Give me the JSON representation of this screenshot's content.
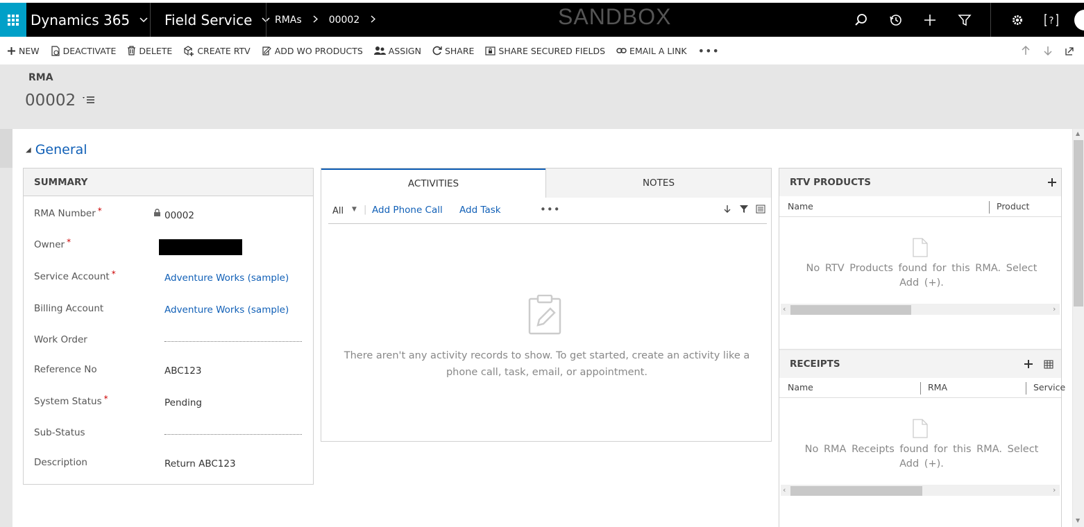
{
  "topnav": {
    "app_name": "Dynamics 365",
    "area_name": "Field Service",
    "breadcrumb": [
      "RMAs",
      "00002"
    ],
    "environment_label": "SANDBOX",
    "icons": [
      "search-icon",
      "recent-icon",
      "add-icon",
      "filter-icon",
      "settings-icon",
      "help-icon",
      "user-avatar"
    ]
  },
  "commandbar": {
    "new": "NEW",
    "deactivate": "DEACTIVATE",
    "delete": "DELETE",
    "create_rtv": "CREATE RTV",
    "add_wo_products": "ADD WO PRODUCTS",
    "assign": "ASSIGN",
    "share": "SHARE",
    "share_secured_fields": "SHARE SECURED FIELDS",
    "email_a_link": "EMAIL A LINK",
    "more": "•••"
  },
  "header": {
    "entity_type": "RMA",
    "record_title": "00002"
  },
  "section": {
    "title": "General"
  },
  "summary": {
    "title": "SUMMARY",
    "fields": [
      {
        "label": "RMA Number",
        "required": true,
        "value": "00002",
        "locked": true
      },
      {
        "label": "Owner",
        "required": true,
        "value": "",
        "redacted": true
      },
      {
        "label": "Service Account",
        "required": true,
        "value": "Adventure Works (sample)",
        "link": true
      },
      {
        "label": "Billing Account",
        "required": false,
        "value": "Adventure Works (sample)",
        "link": true
      },
      {
        "label": "Work Order",
        "required": false,
        "value": ""
      },
      {
        "label": "Reference No",
        "required": false,
        "value": "ABC123"
      },
      {
        "label": "System Status",
        "required": true,
        "value": "Pending"
      },
      {
        "label": "Sub-Status",
        "required": false,
        "value": ""
      },
      {
        "label": "Description",
        "required": false,
        "value": "Return ABC123"
      }
    ],
    "required_mark": "*"
  },
  "activities": {
    "tab_activities": "ACTIVITIES",
    "tab_notes": "NOTES",
    "filter_value": "All",
    "separator": "|",
    "add_phone_call": "Add Phone Call",
    "add_task": "Add Task",
    "more": "•••",
    "empty_message": "There aren't any activity records to show. To get started, create an activity like a phone call, task, email, or appointment."
  },
  "rtv_products": {
    "title": "RTV PRODUCTS",
    "columns": [
      "Name",
      "Product"
    ],
    "empty_message": "No RTV Products found for this RMA. Select Add (+)."
  },
  "receipts": {
    "title": "RECEIPTS",
    "columns": [
      "Name",
      "RMA",
      "Service"
    ],
    "empty_message": "No RMA Receipts found for this RMA. Select Add (+)."
  },
  "colors": {
    "nav_bg": "#000000",
    "waffle_bg": "#00a0c8",
    "link": "#1160b7",
    "required": "#cc0000"
  }
}
